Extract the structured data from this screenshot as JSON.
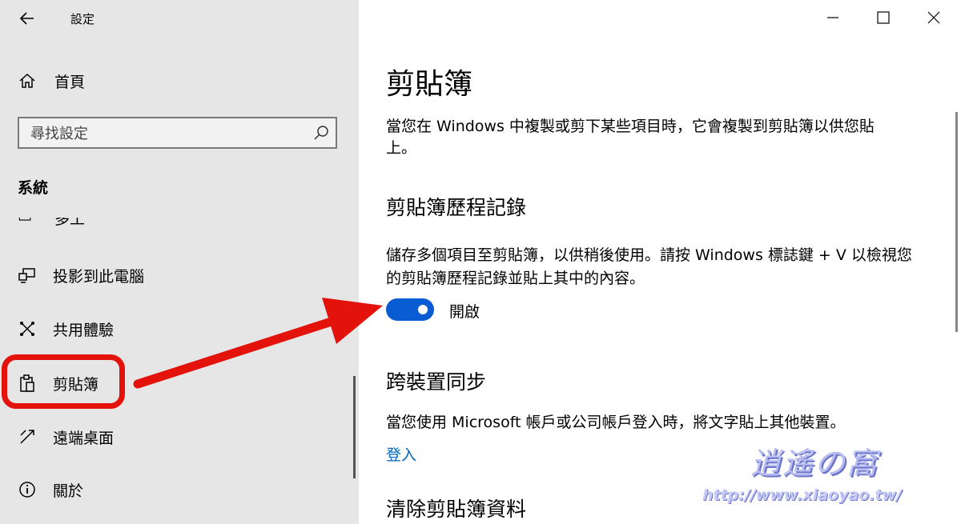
{
  "sidebar": {
    "app_title": "設定",
    "home_label": "首頁",
    "search_placeholder": "尋找設定",
    "section_heading": "系統",
    "partial_item_label": "多工",
    "items": [
      {
        "label": "投影到此電腦",
        "icon": "projector-icon"
      },
      {
        "label": "共用體驗",
        "icon": "shared-experiences-icon"
      },
      {
        "label": "剪貼簿",
        "icon": "clipboard-icon"
      },
      {
        "label": "遠端桌面",
        "icon": "remote-desktop-icon"
      },
      {
        "label": "關於",
        "icon": "info-icon"
      }
    ]
  },
  "main": {
    "title": "剪貼簿",
    "intro": "當您在 Windows 中複製或剪下某些項目時，它會複製到剪貼簿以供您貼上。",
    "history": {
      "heading": "剪貼簿歷程記錄",
      "description": "儲存多個項目至剪貼簿，以供稍後使用。請按 Windows 標誌鍵 + V 以檢視您的剪貼簿歷程記錄並貼上其中的內容。",
      "toggle_state": "開啟",
      "toggle_on": true
    },
    "sync": {
      "heading": "跨裝置同步",
      "description": "當您使用 Microsoft 帳戶或公司帳戶登入時，將文字貼上其他裝置。",
      "signin_link": "登入"
    },
    "clear": {
      "heading": "清除剪貼簿資料"
    }
  },
  "watermark": {
    "logo_text": "逍遙の窩",
    "url": "http://www.xiaoyao.tw/"
  },
  "colors": {
    "accent": "#0a5cd2",
    "sidebar_bg": "#e6e6e6",
    "annotation": "#e3120b",
    "link": "#0067c0"
  }
}
